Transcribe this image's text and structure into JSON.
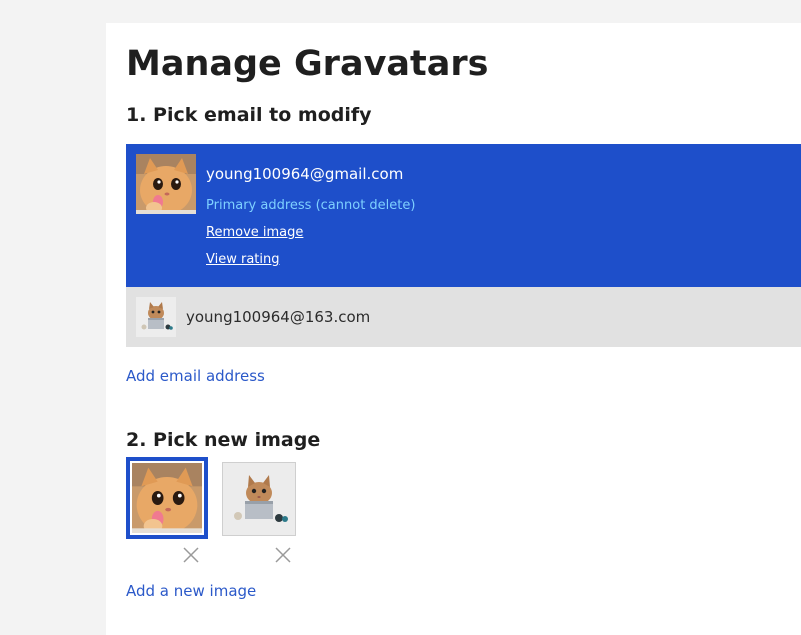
{
  "page": {
    "title": "Manage Gravatars"
  },
  "step1": {
    "heading": "1. Pick email to modify",
    "emails": [
      {
        "address": "young100964@gmail.com",
        "note": "Primary address (cannot delete)",
        "remove_label": "Remove image",
        "rating_label": "View rating",
        "selected": true,
        "avatar_icon": "orange-cat-licking-icon"
      },
      {
        "address": "young100964@163.com",
        "selected": false,
        "avatar_icon": "cat-in-box-icon"
      }
    ],
    "add_email_label": "Add email address"
  },
  "step2": {
    "heading": "2. Pick new image",
    "images": [
      {
        "icon": "orange-cat-licking-icon",
        "selected": true,
        "delete_icon": "close-icon"
      },
      {
        "icon": "cat-in-box-icon",
        "selected": false,
        "delete_icon": "close-icon"
      }
    ],
    "add_image_label": "Add a new image"
  },
  "colors": {
    "selected_bg": "#1e4fca",
    "unselected_bg": "#e1e1e1",
    "link": "#2b59c9",
    "primary_note": "#7ed0ff"
  }
}
